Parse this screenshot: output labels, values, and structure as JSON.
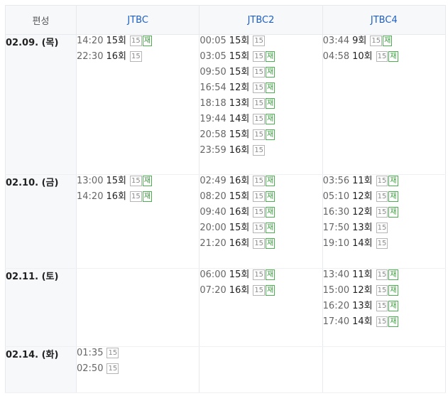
{
  "header": {
    "label": "편성",
    "channels": [
      "JTBC",
      "JTBC2",
      "JTBC4"
    ]
  },
  "rows": [
    {
      "date": "02.09. (목)",
      "cells": [
        [
          {
            "time": "14:20",
            "ep": "15회",
            "rating": "15",
            "re": "재"
          },
          {
            "time": "22:30",
            "ep": "16회",
            "rating": "15"
          }
        ],
        [
          {
            "time": "00:05",
            "ep": "15회",
            "rating": "15"
          },
          {
            "time": "03:05",
            "ep": "15회",
            "rating": "15",
            "re": "재"
          },
          {
            "time": "09:50",
            "ep": "15회",
            "rating": "15",
            "re": "재"
          },
          {
            "time": "16:54",
            "ep": "12회",
            "rating": "15",
            "re": "재"
          },
          {
            "time": "18:18",
            "ep": "13회",
            "rating": "15",
            "re": "재"
          },
          {
            "time": "19:44",
            "ep": "14회",
            "rating": "15",
            "re": "재"
          },
          {
            "time": "20:58",
            "ep": "15회",
            "rating": "15",
            "re": "재"
          },
          {
            "time": "23:59",
            "ep": "16회",
            "rating": "15"
          }
        ],
        [
          {
            "time": "03:44",
            "ep": "9회",
            "rating": "15",
            "re": "재"
          },
          {
            "time": "04:58",
            "ep": "10회",
            "rating": "15",
            "re": "재"
          }
        ]
      ]
    },
    {
      "date": "02.10. (금)",
      "cells": [
        [
          {
            "time": "13:00",
            "ep": "15회",
            "rating": "15",
            "re": "재"
          },
          {
            "time": "14:20",
            "ep": "16회",
            "rating": "15",
            "re": "재"
          }
        ],
        [
          {
            "time": "02:49",
            "ep": "16회",
            "rating": "15",
            "re": "재"
          },
          {
            "time": "08:20",
            "ep": "15회",
            "rating": "15",
            "re": "재"
          },
          {
            "time": "09:40",
            "ep": "16회",
            "rating": "15",
            "re": "재"
          },
          {
            "time": "20:00",
            "ep": "15회",
            "rating": "15",
            "re": "재"
          },
          {
            "time": "21:20",
            "ep": "16회",
            "rating": "15",
            "re": "재"
          }
        ],
        [
          {
            "time": "03:56",
            "ep": "11회",
            "rating": "15",
            "re": "재"
          },
          {
            "time": "05:10",
            "ep": "12회",
            "rating": "15",
            "re": "재"
          },
          {
            "time": "16:30",
            "ep": "12회",
            "rating": "15",
            "re": "재"
          },
          {
            "time": "17:50",
            "ep": "13회",
            "rating": "15"
          },
          {
            "time": "19:10",
            "ep": "14회",
            "rating": "15"
          }
        ]
      ]
    },
    {
      "date": "02.11. (토)",
      "cells": [
        [],
        [
          {
            "time": "06:00",
            "ep": "15회",
            "rating": "15",
            "re": "재"
          },
          {
            "time": "07:20",
            "ep": "16회",
            "rating": "15",
            "re": "재"
          }
        ],
        [
          {
            "time": "13:40",
            "ep": "11회",
            "rating": "15",
            "re": "재"
          },
          {
            "time": "15:00",
            "ep": "12회",
            "rating": "15",
            "re": "재"
          },
          {
            "time": "16:20",
            "ep": "13회",
            "rating": "15",
            "re": "재"
          },
          {
            "time": "17:40",
            "ep": "14회",
            "rating": "15",
            "re": "재"
          }
        ]
      ]
    },
    {
      "date": "02.14. (화)",
      "cells": [
        [
          {
            "time": "01:35",
            "rating": "15"
          },
          {
            "time": "02:50",
            "rating": "15"
          }
        ],
        [],
        []
      ]
    }
  ]
}
